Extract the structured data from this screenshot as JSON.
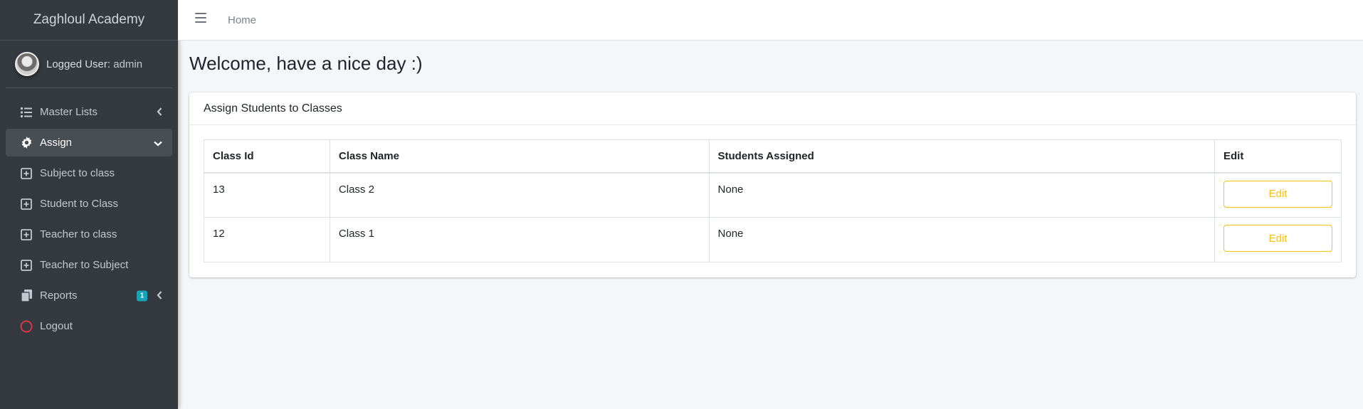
{
  "brand": "Zaghloul Academy",
  "user": {
    "prefix": "Logged User:",
    "name": "admin"
  },
  "sidebar": {
    "items": [
      {
        "label": "Master Lists",
        "icon": "list-icon",
        "chevron": "‹"
      },
      {
        "label": "Assign",
        "icon": "gear-icon",
        "chevron": "⌄",
        "active": true
      },
      {
        "label": "Subject to class",
        "icon": "plus-square-icon"
      },
      {
        "label": "Student to Class",
        "icon": "plus-square-icon"
      },
      {
        "label": "Teacher to class",
        "icon": "plus-square-icon"
      },
      {
        "label": "Teacher to Subject",
        "icon": "plus-square-icon"
      },
      {
        "label": "Reports",
        "icon": "copy-icon",
        "badge": "1",
        "chevron": "‹"
      },
      {
        "label": "Logout",
        "icon": "circle-icon"
      }
    ]
  },
  "topbar": {
    "home": "Home"
  },
  "main": {
    "title": "Welcome, have a nice day :)",
    "card_title": "Assign Students to Classes",
    "table": {
      "headers": [
        "Class Id",
        "Class Name",
        "Students Assigned",
        "Edit"
      ],
      "rows": [
        {
          "id": "13",
          "name": "Class 2",
          "students": "None",
          "edit": "Edit"
        },
        {
          "id": "12",
          "name": "Class 1",
          "students": "None",
          "edit": "Edit"
        }
      ]
    }
  },
  "colors": {
    "sidebar": "#343a40",
    "active": "#494e53",
    "warning": "#ffc107",
    "badge": "#17a2b8",
    "logout_icon": "#dc3545"
  }
}
